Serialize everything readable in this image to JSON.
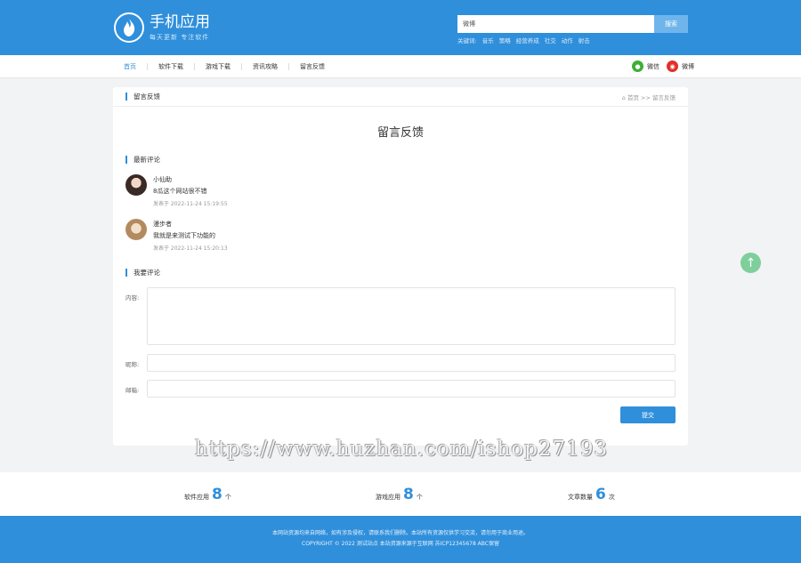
{
  "header": {
    "logo_title": "手机应用",
    "logo_slogan": "每天更新  专注软件",
    "search_value": "微博",
    "search_button": "搜索",
    "keywords_label": "关键词:",
    "keywords": [
      "音乐",
      "策略",
      "经营养成",
      "社交",
      "动作",
      "射击"
    ]
  },
  "nav": {
    "items": [
      "首页",
      "软件下载",
      "游戏下载",
      "资讯攻略",
      "留言反馈"
    ],
    "active": "首页",
    "share_wechat": "微信",
    "share_weibo": "微博"
  },
  "panel": {
    "head_title": "留言反馈",
    "breadcrumb": "首页 >> 留言反馈",
    "page_title": "留言反馈",
    "latest_title": "最新评论",
    "comments": [
      {
        "name": "小仙助",
        "text": "8瓜这个网站很不错",
        "time": "发表于 2022-11-24 15:19:55"
      },
      {
        "name": "漫步者",
        "text": "我就是来测试下功能的",
        "time": "发表于 2022-11-24 15:20:13"
      }
    ],
    "post_title": "我要评论",
    "form": {
      "content_label": "内容:",
      "nickname_label": "昵称:",
      "email_label": "邮箱:",
      "submit": "提交"
    }
  },
  "watermark": "https://www.huzhan.com/ishop27193",
  "stats": [
    {
      "label": "软件应用",
      "value": "8",
      "unit": "个"
    },
    {
      "label": "游戏应用",
      "value": "8",
      "unit": "个"
    },
    {
      "label": "文章数量",
      "value": "6",
      "unit": "次"
    }
  ],
  "footer": {
    "line1": "本网站资源均来自网络，如有涉及侵权，请联系我们删除。本站所有资源仅供学习交流，请勿用于商业用途。",
    "line2": "COPYRIGHT © 2022 测试站点 本站资源来源于互联网 苏ICP12345678 ABC保留"
  },
  "colors": {
    "brand": "#2f8fdb",
    "to_top": "#7ecf9b"
  }
}
